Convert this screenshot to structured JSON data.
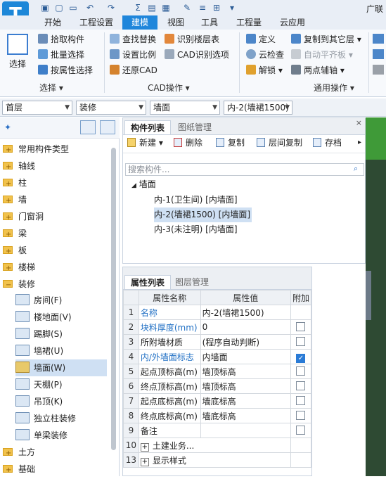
{
  "title_bar": {
    "logo": "T",
    "brand": "广联"
  },
  "menu_tabs": [
    "开始",
    "工程设置",
    "建模",
    "视图",
    "工具",
    "工程量",
    "云应用"
  ],
  "active_tab": "建模",
  "ribbon": {
    "select_label": "选择",
    "select_group": [
      "拾取构件",
      "批量选择",
      "按属性选择"
    ],
    "select_group_title": "选择",
    "cad_group": [
      "查找替换",
      "识别楼层表",
      "设置比例",
      "CAD识别选项",
      "还原CAD"
    ],
    "cad_group_title": "CAD操作",
    "common_group": [
      "定义",
      "复制到其它层",
      "云检查",
      "自动平齐板",
      "解锁",
      "两点辅轴"
    ],
    "common_group_title": "通用操作"
  },
  "combos": {
    "floor": "首层",
    "category": "装修",
    "type": "墙面",
    "component": "内-2(墙裙1500)"
  },
  "tree": {
    "items": [
      "常用构件类型",
      "轴线",
      "柱",
      "墙",
      "门窗洞",
      "梁",
      "板",
      "楼梯",
      "装修"
    ],
    "sub_items": [
      "房间(F)",
      "楼地面(V)",
      "踢脚(S)",
      "墙裙(U)",
      "墙面(W)",
      "天棚(P)",
      "吊顶(K)",
      "独立柱装修",
      "单梁装修"
    ],
    "after_items": [
      "土方",
      "基础"
    ],
    "selected": "墙面(W)"
  },
  "component_list": {
    "tabs": [
      "构件列表",
      "图纸管理"
    ],
    "toolbar": [
      "新建",
      "删除",
      "复制",
      "层间复制",
      "存档"
    ],
    "search_placeholder": "搜索构件...",
    "root": "墙面",
    "items": [
      "内-1(卫生间) [内墙面]",
      "内-2(墙裙1500) [内墙面]",
      "内-3(未注明) [内墙面]"
    ],
    "selected_index": 1
  },
  "property_list": {
    "tabs": [
      "属性列表",
      "图层管理"
    ],
    "headers": [
      "属性名称",
      "属性值",
      "附加"
    ],
    "rows": [
      {
        "n": "1",
        "name": "名称",
        "value": "内-2(墙裙1500)",
        "blue": true,
        "check": null
      },
      {
        "n": "2",
        "name": "块料厚度(mm)",
        "value": "0",
        "blue": true,
        "check": false
      },
      {
        "n": "3",
        "name": "所附墙材质",
        "value": "(程序自动判断)",
        "blue": false,
        "check": false
      },
      {
        "n": "4",
        "name": "内/外墙面标志",
        "value": "内墙面",
        "blue": true,
        "check": true
      },
      {
        "n": "5",
        "name": "起点顶标高(m)",
        "value": "墙顶标高",
        "blue": false,
        "check": false
      },
      {
        "n": "6",
        "name": "终点顶标高(m)",
        "value": "墙顶标高",
        "blue": false,
        "check": false
      },
      {
        "n": "7",
        "name": "起点底标高(m)",
        "value": "墙底标高",
        "blue": false,
        "check": false
      },
      {
        "n": "8",
        "name": "终点底标高(m)",
        "value": "墙底标高",
        "blue": false,
        "check": false
      },
      {
        "n": "9",
        "name": "备注",
        "value": "",
        "blue": false,
        "check": false
      },
      {
        "n": "10",
        "name": "土建业务...",
        "value": "",
        "blue": false,
        "check": null,
        "expand": true
      },
      {
        "n": "13",
        "name": "显示样式",
        "value": "",
        "blue": false,
        "check": null,
        "expand": true
      }
    ]
  }
}
